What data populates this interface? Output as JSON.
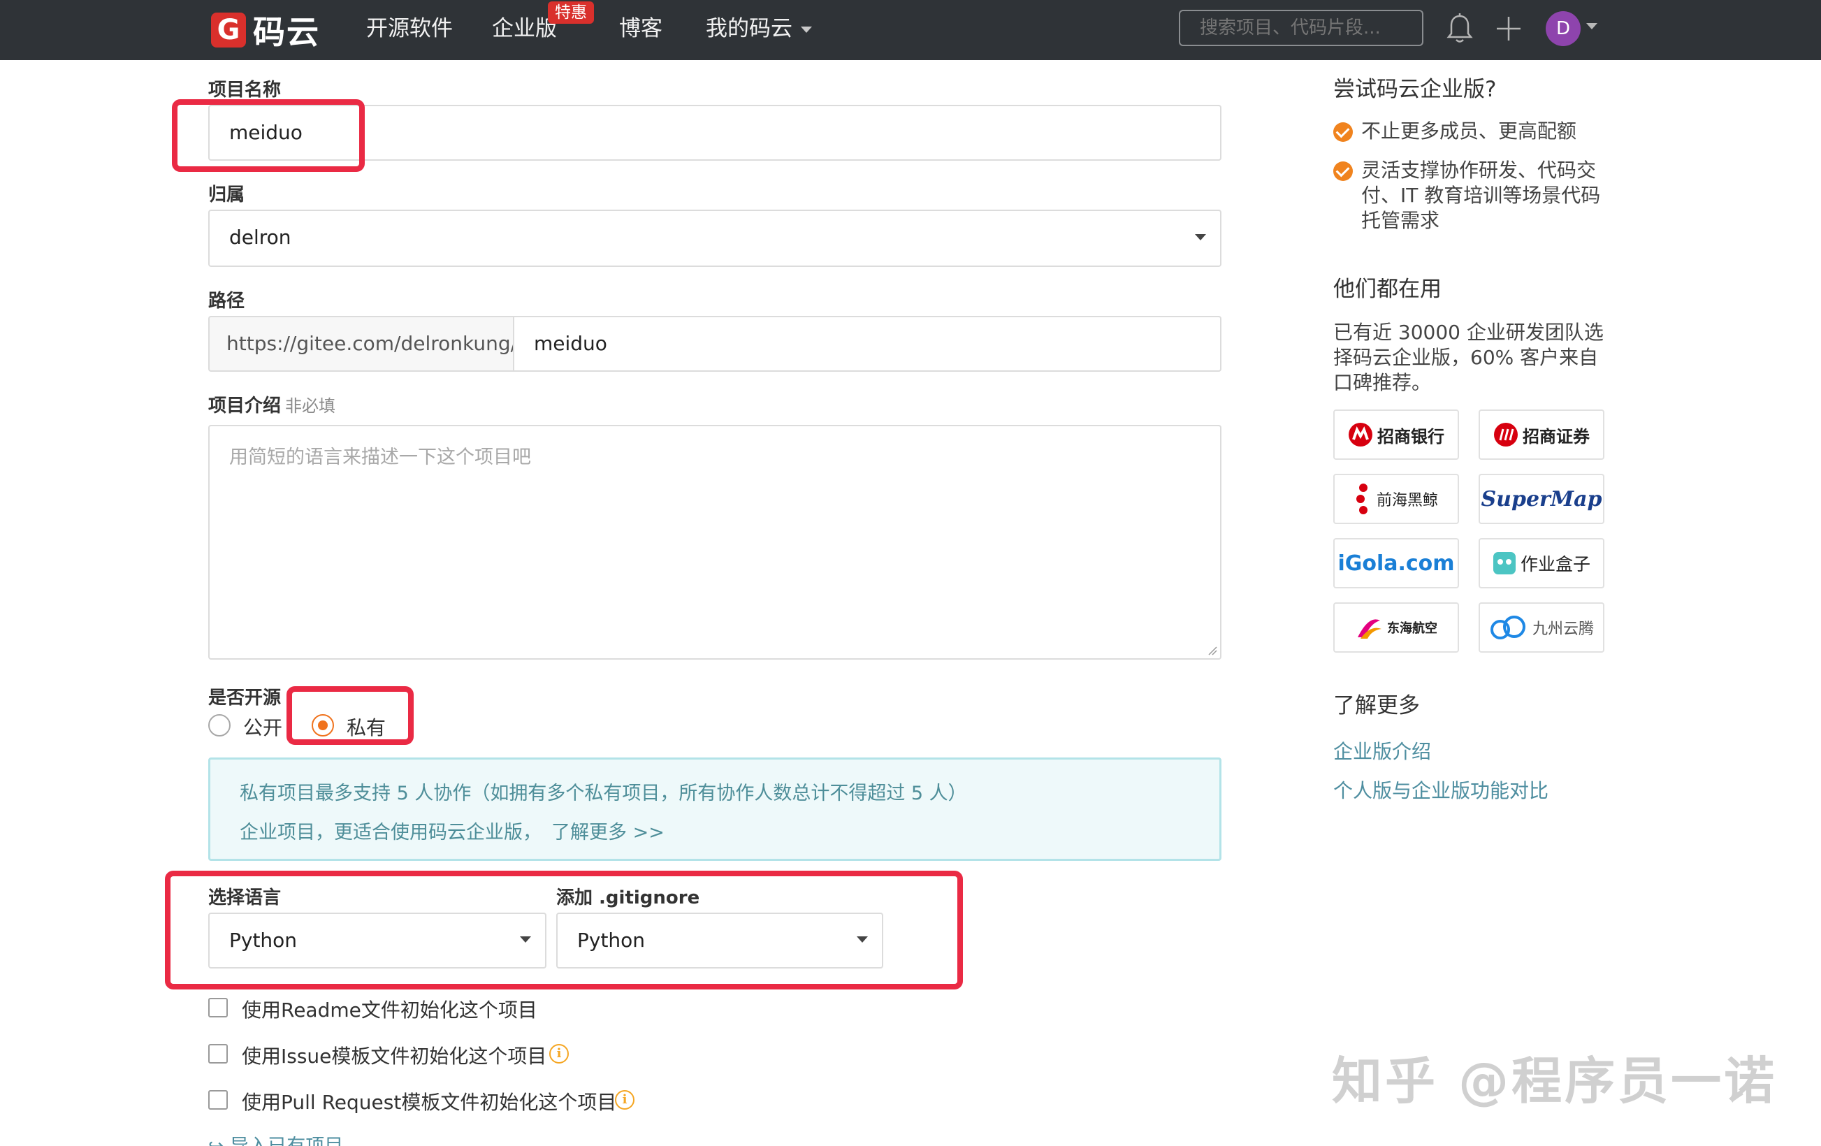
{
  "navbar": {
    "logo_letter": "G",
    "logo_text": "码云",
    "items": [
      "开源软件",
      "企业版",
      "博客",
      "我的码云"
    ],
    "badge": "特惠",
    "search_placeholder": "搜索项目、代码片段...",
    "avatar_letter": "D"
  },
  "form": {
    "name": {
      "label": "项目名称",
      "value": "meiduo"
    },
    "owner": {
      "label": "归属",
      "value": "delron"
    },
    "path": {
      "label": "路径",
      "prefix": "https://gitee.com/delronkung/",
      "value": "meiduo"
    },
    "description": {
      "label": "项目介绍",
      "optional": "非必填",
      "placeholder": "用简短的语言来描述一下这个项目吧"
    },
    "visibility": {
      "label": "是否开源",
      "options": [
        "公开",
        "私有"
      ],
      "selected": "私有"
    },
    "notice": {
      "line1": "私有项目最多支持 5 人协作（如拥有多个私有项目，所有协作人数总计不得超过 5 人）",
      "line2": "企业项目，更适合使用码云企业版，",
      "line2_link": "了解更多 >>"
    },
    "language": {
      "label": "选择语言",
      "value": "Python"
    },
    "gitignore": {
      "label": "添加 .gitignore",
      "value": "Python"
    },
    "checkboxes": [
      "使用Readme文件初始化这个项目",
      "使用Issue模板文件初始化这个项目",
      "使用Pull Request模板文件初始化这个项目"
    ],
    "import_link": "导入已有项目"
  },
  "sidebar": {
    "try_title": "尝试码云企业版?",
    "benefits": [
      "不止更多成员、更高配额",
      "灵活支撑协作研发、代码交付、IT 教育培训等场景代码托管需求"
    ],
    "users_title": "他们都在用",
    "users_text": "已有近 30000 企业研发团队选择码云企业版，60% 客户来自口碑推荐。",
    "logos": [
      "招商银行",
      "招商证券",
      "前海黑鲸",
      "SuperMap",
      "iGola.com",
      "作业盒子",
      "东海航空",
      "九州云腾"
    ],
    "learn_title": "了解更多",
    "links": [
      "企业版介绍",
      "个人版与企业版功能对比"
    ]
  },
  "watermark": "知乎 @程序员一诺"
}
